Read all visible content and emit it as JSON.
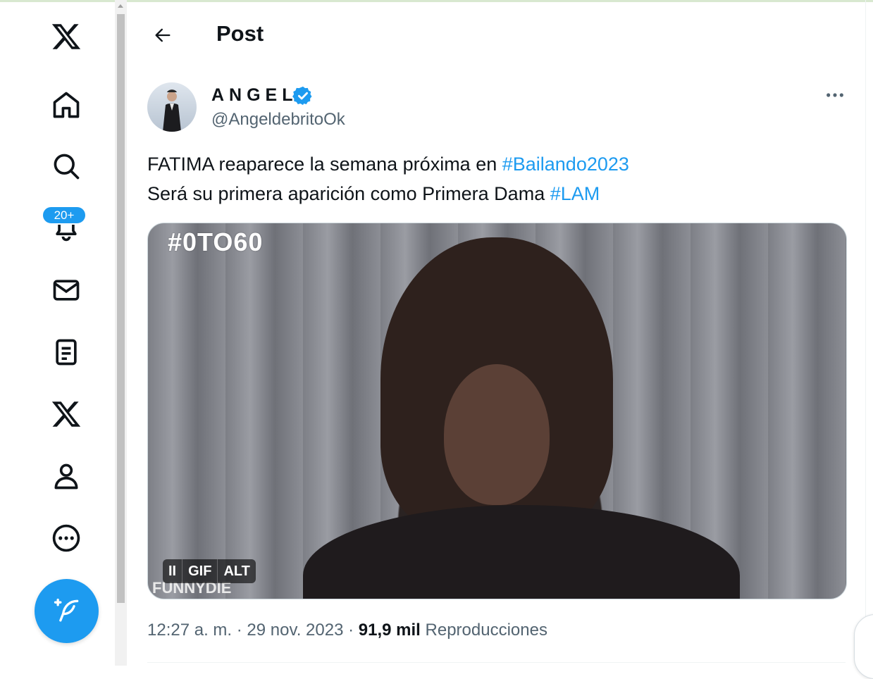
{
  "nav": {
    "items": [
      {
        "name": "x-logo",
        "icon": "x-logo-icon"
      },
      {
        "name": "home",
        "icon": "home-icon"
      },
      {
        "name": "explore",
        "icon": "search-icon"
      },
      {
        "name": "notifications",
        "icon": "bell-icon"
      },
      {
        "name": "messages",
        "icon": "mail-icon"
      },
      {
        "name": "lists",
        "icon": "list-icon"
      },
      {
        "name": "premium",
        "icon": "x-logo-icon"
      },
      {
        "name": "profile",
        "icon": "person-icon"
      },
      {
        "name": "more",
        "icon": "more-circle-icon"
      }
    ],
    "notifications_badge": "20+",
    "compose_icon": "compose-feather-icon"
  },
  "header": {
    "back_icon": "arrow-left-icon",
    "title": "Post"
  },
  "post": {
    "author_name": "ANGEL",
    "verified_icon": "verified-badge-icon",
    "handle": "@AngeldebritoOk",
    "more_icon": "more-horizontal-icon",
    "text_line1": "FATIMA reaparece la semana próxima en ",
    "hashtag1": "#Bailando2023",
    "text_line2": "Será su primera aparición como Primera Dama ",
    "hashtag2": "#LAM",
    "media": {
      "brand_top": "#0TO60",
      "brand_bottom": "FUNNYDIE",
      "controls": [
        "II",
        "GIF",
        "ALT"
      ]
    },
    "time": "12:27 a. m.",
    "separator": "·",
    "date": "29 nov. 2023",
    "views_count": "91,9 mil",
    "views_label": "Reproducciones"
  },
  "colors": {
    "accent": "#1d9bf0",
    "text": "#0f1419",
    "secondary": "#536471"
  }
}
